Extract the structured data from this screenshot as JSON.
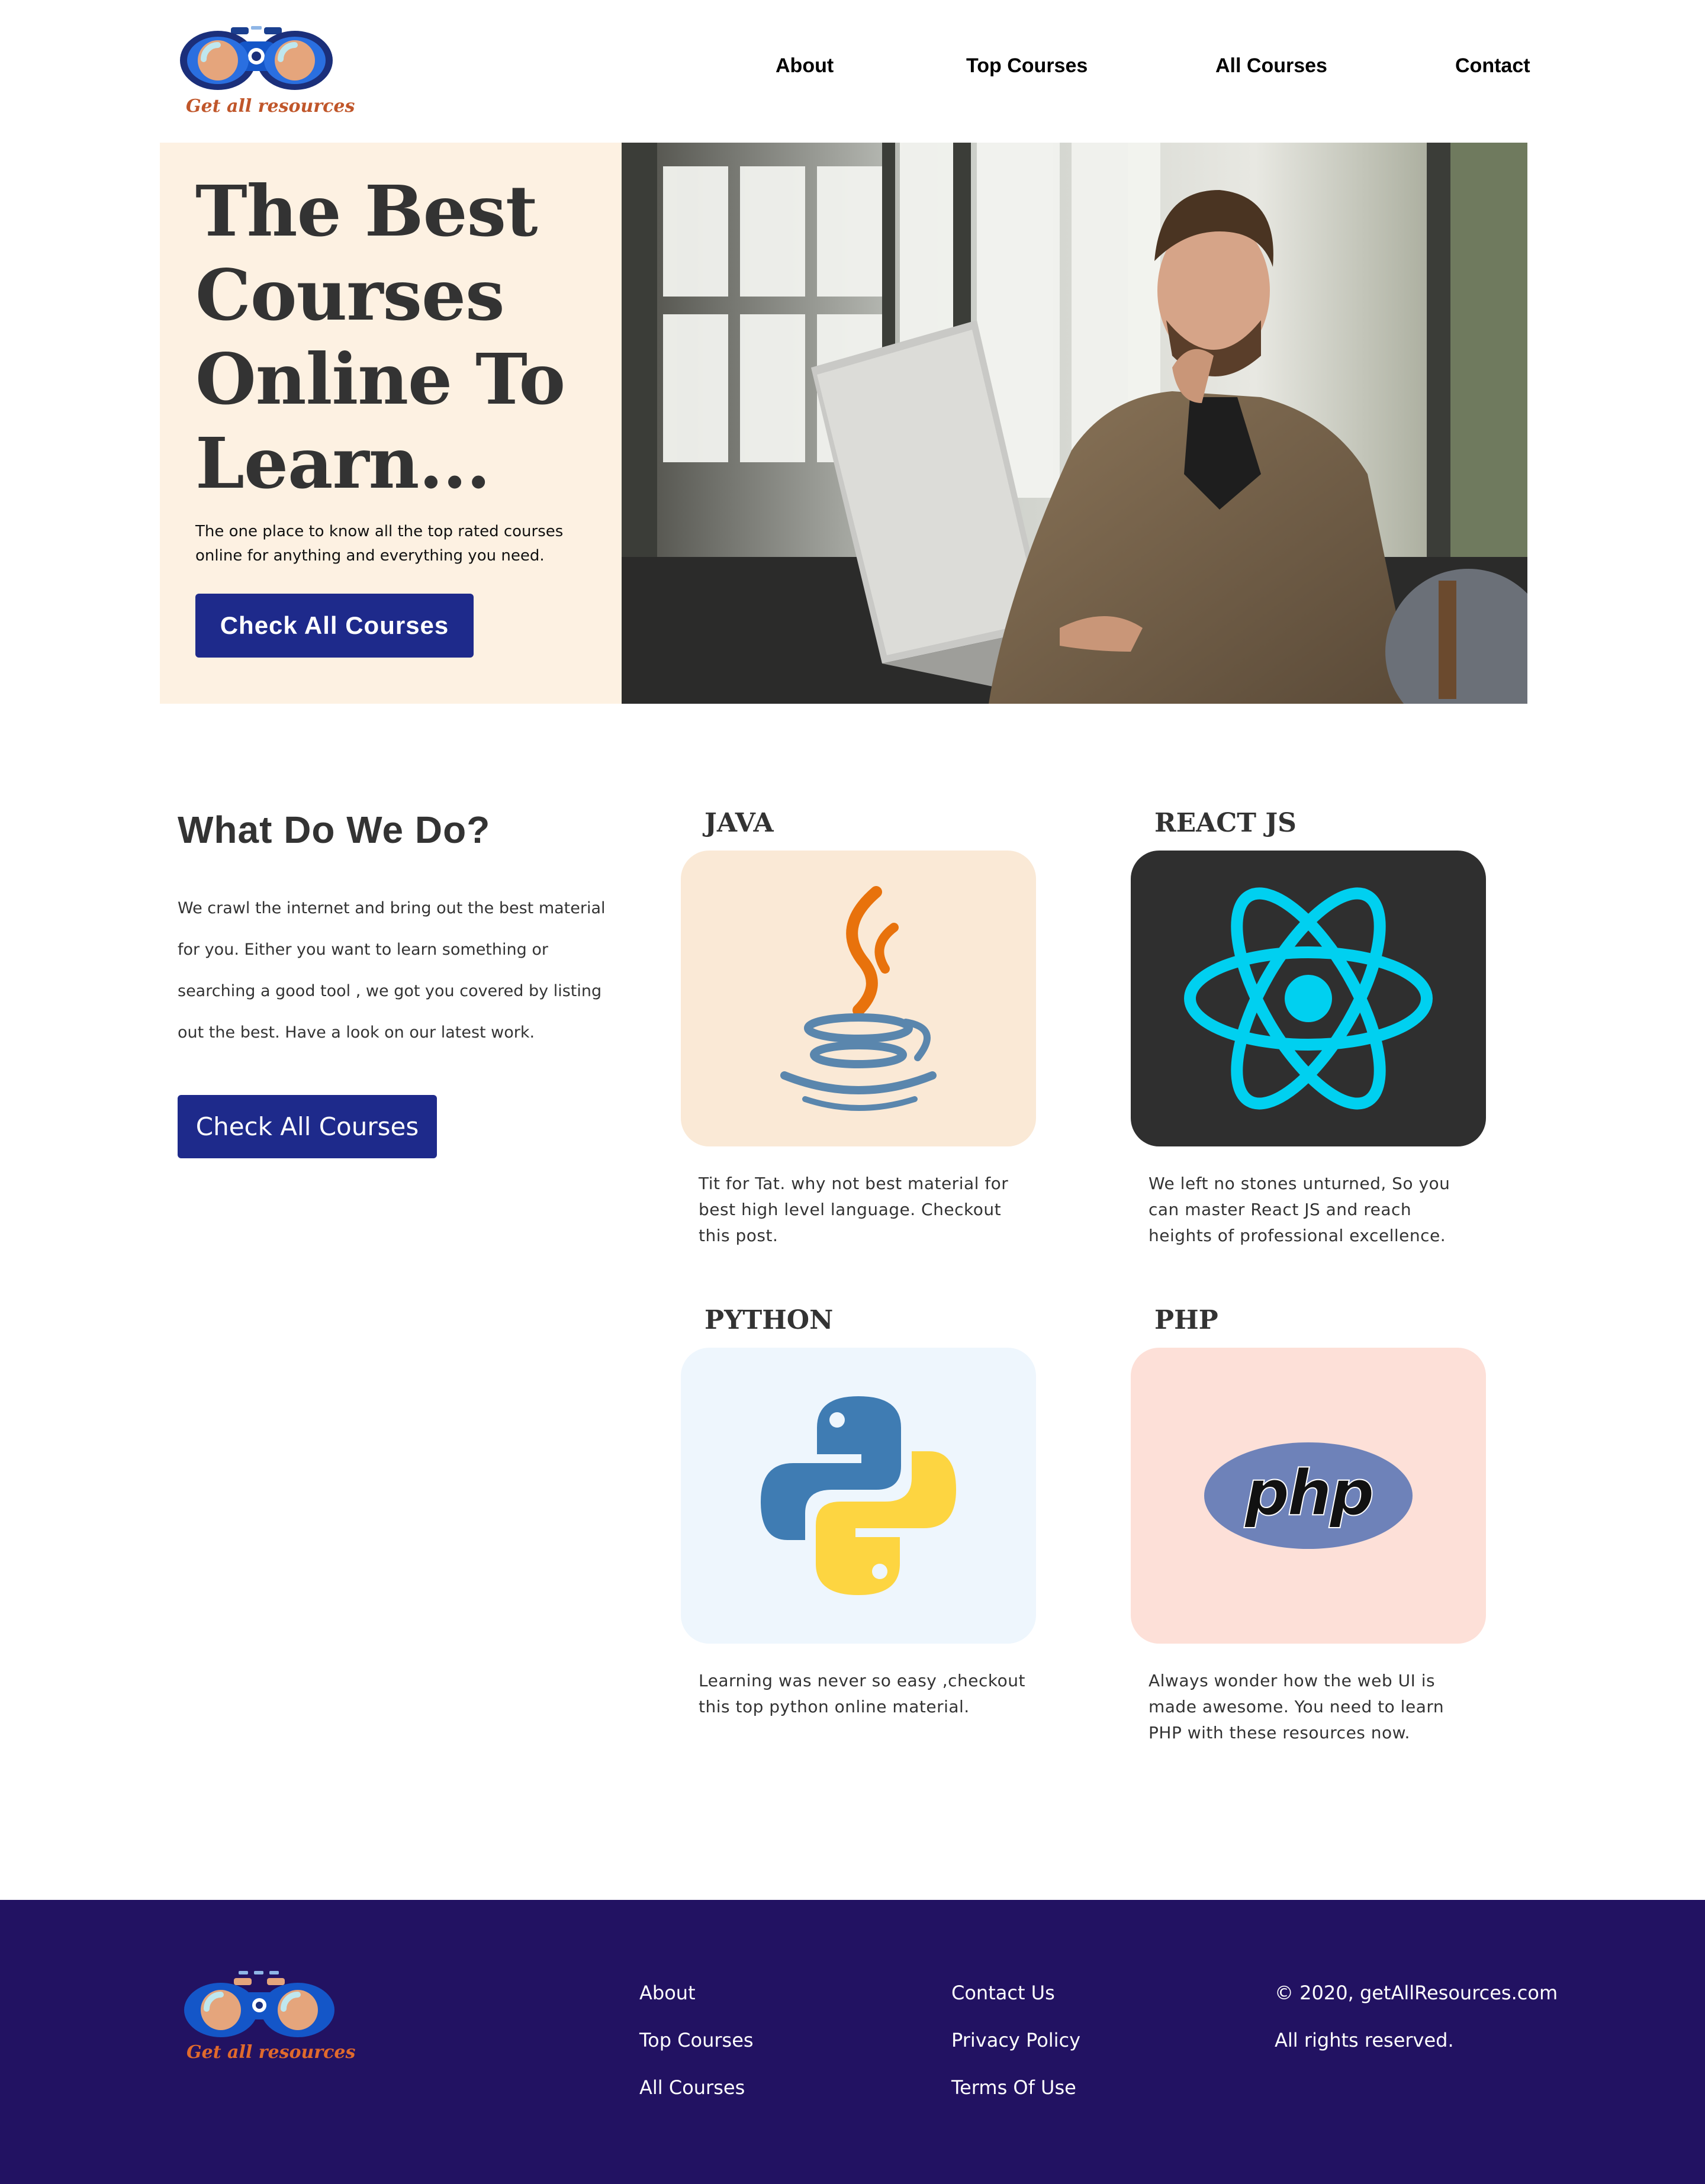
{
  "brand": {
    "logo_text": "Get all resources"
  },
  "nav": {
    "items": [
      "About",
      "Top Courses",
      "All Courses",
      "Contact"
    ]
  },
  "hero": {
    "title": "The Best Courses Online To Learn...",
    "subtitle": "The one place to know all the top rated courses online for anything and everything you need.",
    "cta": "Check All Courses"
  },
  "what_we_do": {
    "title": "What Do We Do?",
    "body": "We crawl the internet and bring out the best material for you. Either you want to learn something or searching a good tool , we got you covered by listing out the best. Have a look on our latest work.",
    "cta": "Check All Courses"
  },
  "cards": [
    {
      "title": "JAVA",
      "icon": "java-icon",
      "bg": "#fae9d6",
      "desc": "Tit for Tat. why not best material for best high level language. Checkout this post."
    },
    {
      "title": "REACT JS",
      "icon": "react-icon",
      "bg": "#2f2f2f",
      "desc": "We left no stones unturned, So you can master React JS and reach heights of professional excellence."
    },
    {
      "title": "PYTHON",
      "icon": "python-icon",
      "bg": "#eef6fd",
      "desc": "Learning was never so easy ,checkout this top python online material."
    },
    {
      "title": "PHP",
      "icon": "php-icon",
      "bg": "#fde0d8",
      "desc": "Always wonder how the web UI is made awesome. You need to learn PHP with these resources now."
    }
  ],
  "footer": {
    "logo_text": "Get all resources",
    "col1": [
      "About",
      "Top Courses",
      "All Courses"
    ],
    "col2": [
      "Contact Us",
      "Privacy Policy",
      "Terms Of Use"
    ],
    "copyright": "© 2020, getAllResources.com",
    "rights": "All rights reserved."
  },
  "colors": {
    "primary_button": "#1e2a8b",
    "footer_bg": "#221262",
    "hero_bg": "#fdf1e2"
  }
}
